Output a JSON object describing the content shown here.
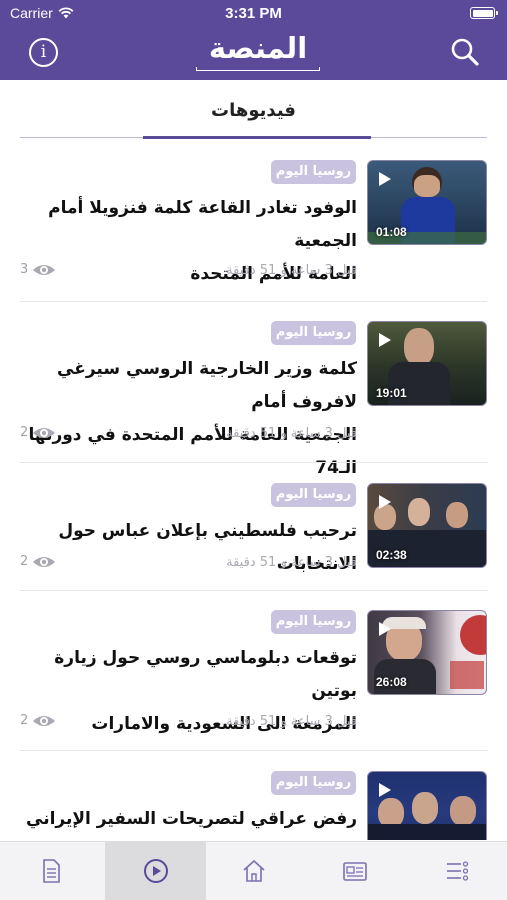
{
  "status_bar": {
    "carrier": "Carrier",
    "time": "3:31 PM"
  },
  "header": {
    "logo_text": "المنصة",
    "info_label": "i"
  },
  "tab": {
    "label": "فيديوهات"
  },
  "videos": [
    {
      "source": "روسيا اليوم",
      "title_lines": [
        "الوفود تغادر القاعة كلمة فنزويلا أمام الجمعية",
        "العامة للأمم المتحدة"
      ],
      "time_ago": "قبل 3 ساعة و 51 دقيقة",
      "views": "3",
      "duration": "01:08"
    },
    {
      "source": "روسيا اليوم",
      "title_lines": [
        "كلمة وزير الخارجية الروسي سيرغي لافروف أمام",
        "الجمعية العامة للأمم المتحدة في دورتها الـ74"
      ],
      "time_ago": "قبل 3 ساعة و 51 دقيقة",
      "views": "2",
      "duration": "19:01"
    },
    {
      "source": "روسيا اليوم",
      "title_lines": [
        "ترحيب فلسطيني بإعلان عباس حول الانتخابات"
      ],
      "time_ago": "قبل 3 ساعة و 51 دقيقة",
      "views": "2",
      "duration": "02:38"
    },
    {
      "source": "روسيا اليوم",
      "title_lines": [
        "توقعات دبلوماسي روسي حول  زيارة بوتين",
        "المزمعة الى السعودية والامارات"
      ],
      "time_ago": "قبل 3 ساعة و 51 دقيقة",
      "views": "2",
      "duration": "26:08"
    },
    {
      "source": "روسيا اليوم",
      "title_lines": [
        "رفض عراقي لتصريحات السفير الإيراني"
      ],
      "time_ago": "",
      "views": "",
      "duration": ""
    }
  ],
  "tab_bar": {
    "items": [
      {
        "icon": "document-icon",
        "active": false
      },
      {
        "icon": "play-circle-icon",
        "active": true
      },
      {
        "icon": "home-icon",
        "active": false
      },
      {
        "icon": "newspaper-icon",
        "active": false
      },
      {
        "icon": "menu-list-icon",
        "active": false
      }
    ]
  },
  "colors": {
    "brand": "#5a4a99",
    "badge": "#c9c3e0",
    "meta_text": "#a9a9b3",
    "tabbar_bg": "#f3f3f6",
    "tabbar_active": "#dcdcdf"
  }
}
